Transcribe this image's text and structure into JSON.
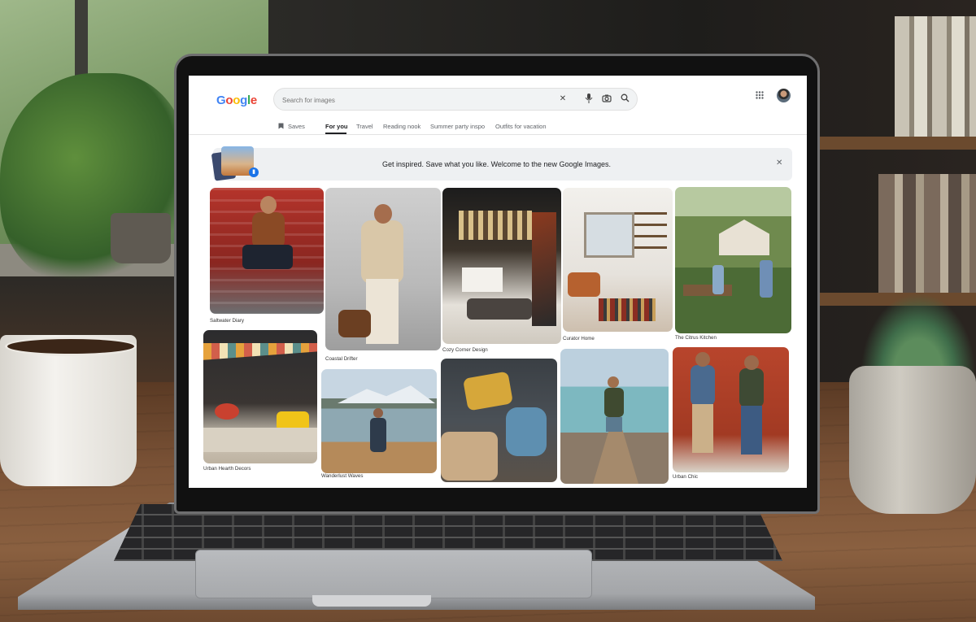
{
  "app": {
    "logo": "Google"
  },
  "search": {
    "placeholder": "Search for images"
  },
  "icons": {
    "clear": "close-icon",
    "voice": "mic-icon",
    "lens": "camera-icon",
    "search": "search-icon",
    "apps": "apps-grid-icon"
  },
  "nav": {
    "saves": "Saves",
    "tabs": [
      "For you",
      "Travel",
      "Reading nook",
      "Summer party inspo",
      "Outfits for vacation"
    ],
    "active": "For you"
  },
  "banner": {
    "text": "Get inspired. Save what you like. Welcome to the new Google Images."
  },
  "gallery": [
    {
      "caption": "Saltwater Diary"
    },
    {
      "caption": "Coastal Drifter"
    },
    {
      "caption": "Cozy Corner Design"
    },
    {
      "caption": "Curator Home"
    },
    {
      "caption": "The Citrus Kitchen"
    },
    {
      "caption": "Urban Hearth Decors"
    },
    {
      "caption": "Wanderlust Waves"
    },
    {
      "caption": ""
    },
    {
      "caption": ""
    },
    {
      "caption": "Urban Chic"
    }
  ],
  "colors": {
    "google_blue": "#4285F4",
    "google_red": "#EA4335",
    "google_yellow": "#FBBC05",
    "google_green": "#34A853",
    "accent": "#1a73e8"
  }
}
